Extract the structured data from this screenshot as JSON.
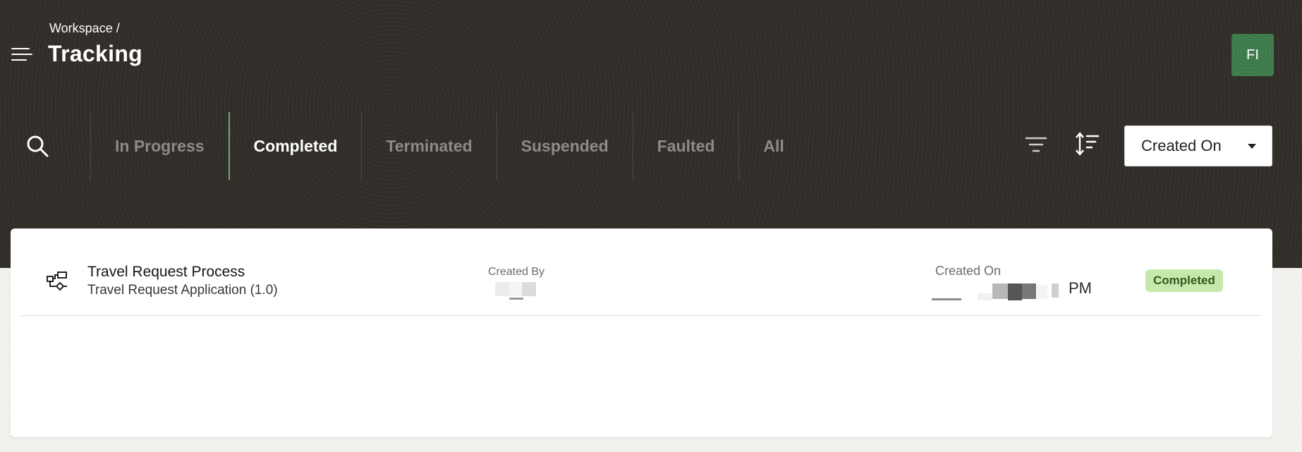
{
  "header": {
    "breadcrumb": "Workspace /",
    "title": "Tracking",
    "avatar_initials": "FI",
    "avatar_color": "#3d7a4a"
  },
  "icons": {
    "menu": "hamburger-menu-icon",
    "search": "search-icon",
    "filter": "filter-icon",
    "sort": "sort-icon",
    "process": "process-flow-icon",
    "dropdown": "caret-down-icon"
  },
  "tabs": [
    {
      "label": "In Progress",
      "active": false
    },
    {
      "label": "Completed",
      "active": true
    },
    {
      "label": "Terminated",
      "active": false
    },
    {
      "label": "Suspended",
      "active": false
    },
    {
      "label": "Faulted",
      "active": false
    },
    {
      "label": "All",
      "active": false
    }
  ],
  "sort": {
    "selected": "Created On"
  },
  "rows": [
    {
      "title": "Travel Request Process",
      "subtitle": "Travel Request Application (1.0)",
      "created_by_label": "Created By",
      "created_on_label": "Created On",
      "created_on_suffix": "PM",
      "status": "Completed"
    }
  ],
  "colors": {
    "header_bg": "#302c28",
    "active_tab_indicator": "#6fae6a",
    "status_completed_bg": "#c6e8ad",
    "status_completed_text": "#2f5a1e"
  }
}
